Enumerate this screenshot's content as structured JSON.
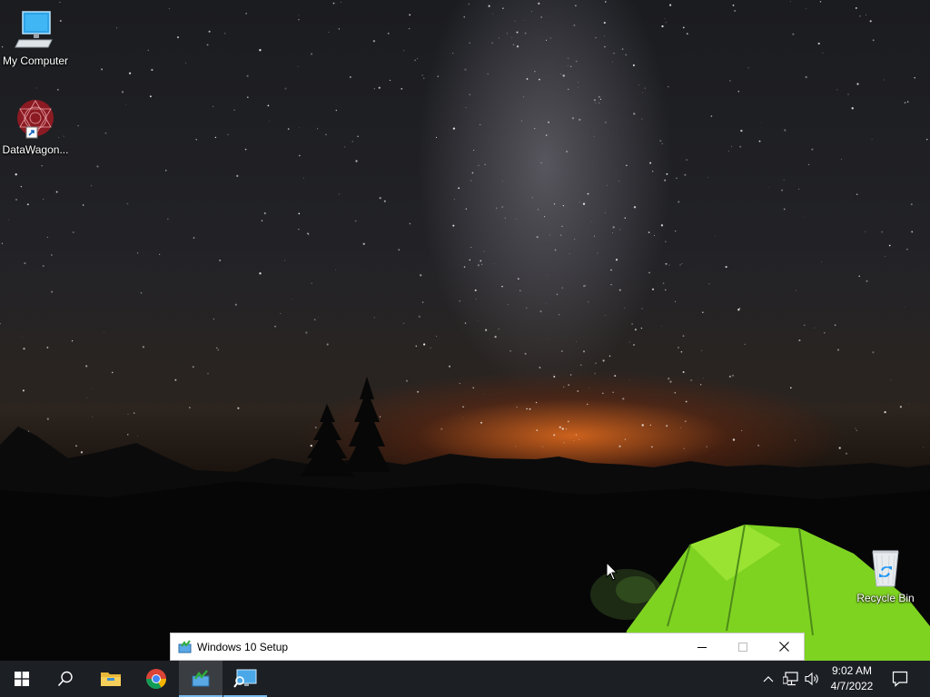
{
  "desktop": {
    "icons": [
      {
        "label": "My Computer",
        "icon": "monitor-icon"
      },
      {
        "label": "DataWagon...",
        "icon": "datawagon-icon"
      },
      {
        "label": "Recycle Bin",
        "icon": "recycle-bin-icon"
      }
    ]
  },
  "setup_window": {
    "title": "Windows 10 Setup",
    "icon": "setup-icon",
    "buttons": [
      "minimize-icon",
      "maximize-icon",
      "close-icon"
    ]
  },
  "taskbar": {
    "buttons": [
      {
        "name": "start",
        "icon": "windows-logo-icon"
      },
      {
        "name": "search",
        "icon": "search-icon"
      },
      {
        "name": "file-explorer",
        "icon": "folder-icon"
      },
      {
        "name": "chrome",
        "icon": "chrome-icon"
      },
      {
        "name": "windows-setup",
        "icon": "setup-icon",
        "active": true
      },
      {
        "name": "remote-desktop",
        "icon": "monitor-search-icon",
        "running": true
      }
    ],
    "tray": {
      "icons": [
        "chevron-up-icon",
        "network-icon",
        "volume-icon"
      ],
      "time": "9:02 AM",
      "date": "4/7/2022",
      "notification_icon": "notification-icon"
    }
  },
  "colors": {
    "taskbar_bg": "#1c1f24",
    "accent": "#76b9ed",
    "tent_green": "#7ed321"
  }
}
